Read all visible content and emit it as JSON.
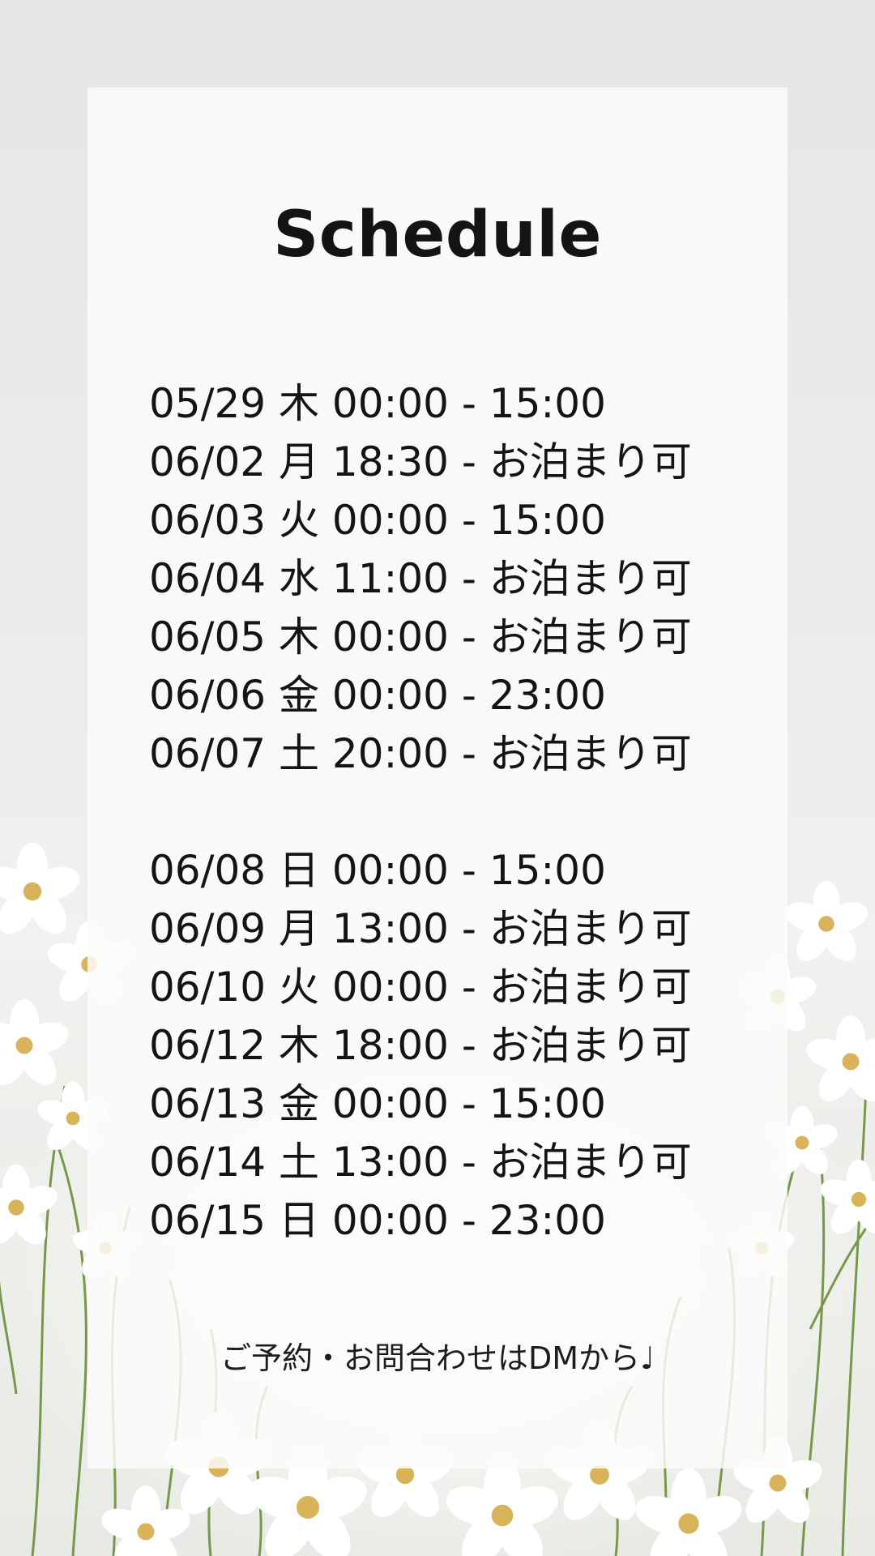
{
  "title": "Schedule",
  "schedule_week_1": [
    "05/29 木 00:00 - 15:00",
    "06/02 月 18:30 - お泊まり可",
    "06/03 火 00:00 - 15:00",
    "06/04 水 11:00 - お泊まり可",
    "06/05 木 00:00 - お泊まり可",
    "06/06 金 00:00 - 23:00",
    "06/07 土 20:00 - お泊まり可"
  ],
  "schedule_week_2": [
    "06/08 日 00:00 - 15:00",
    "06/09 月 13:00 - お泊まり可",
    "06/10 火 00:00 - お泊まり可",
    "06/12 木 18:00 - お泊まり可",
    "06/13 金 00:00 - 15:00",
    "06/14 土 13:00 - お泊まり可",
    "06/15 日 00:00 - 23:00"
  ],
  "footer": "ご予約・お問合わせはDMから♩",
  "colors": {
    "background": "#e9e9e7",
    "card": "#fbfbfa",
    "text": "#141414",
    "stem": "#6b8f3a",
    "flower": "#ffffff",
    "flower_center": "#d8b35a"
  },
  "icons": [
    "white-flower-icon"
  ]
}
